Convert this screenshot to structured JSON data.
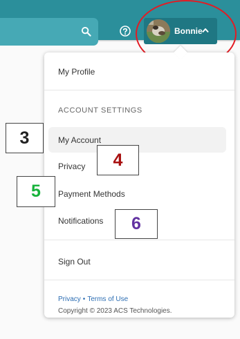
{
  "header": {
    "user_name": "Bonnie",
    "colors": {
      "bar": "#2b8f9b",
      "search_box": "#46a9b5",
      "user_pill": "#1f7783"
    },
    "icons": {
      "search": "search-icon",
      "help": "help-icon",
      "chevron": "chevron-up-icon"
    }
  },
  "menu": {
    "my_profile": "My Profile",
    "account_settings_header": "ACCOUNT SETTINGS",
    "items": [
      {
        "label": "My Account"
      },
      {
        "label": "Privacy"
      },
      {
        "label": "Payment Methods"
      },
      {
        "label": "Notifications"
      }
    ],
    "sign_out": "Sign Out"
  },
  "footer": {
    "privacy_link": "Privacy",
    "separator": "•",
    "terms_link": "Terms of Use",
    "copyright": "Copyright © 2023 ACS Technologies."
  },
  "annotations": {
    "n3": "3",
    "n4": "4",
    "n5": "5",
    "n6": "6",
    "colors": {
      "n3": "#222222",
      "n4": "#a81010",
      "n5": "#17b33b",
      "n6": "#6232a1",
      "circle": "#e31b23"
    }
  }
}
